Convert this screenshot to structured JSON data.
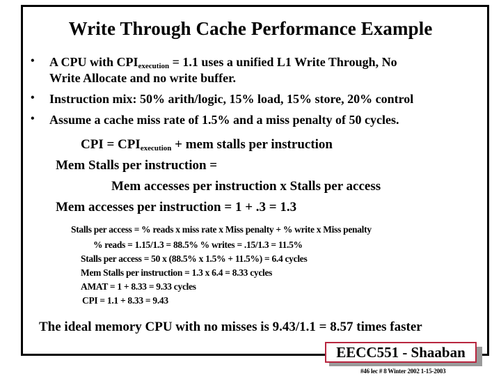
{
  "slide": {
    "title": "Write Through Cache Performance Example",
    "bullets": [
      {
        "pre": "A CPU with  CPI",
        "sub": "execution",
        "post": " =  1.1 uses a unified L1 Write Through, No",
        "line2": "Write Allocate and no write buffer."
      },
      {
        "text": "Instruction mix:   50% arith/logic,  15% load, 15% store, 20% control"
      },
      {
        "text": "Assume a cache miss rate of 1.5%  and  a miss penalty of 50 cycles."
      }
    ],
    "bullet_glyph": "•",
    "equations": {
      "cpi_pre": "CPI =    CPI",
      "cpi_sub": "execution",
      "cpi_post": "   +    mem stalls per instruction",
      "mem_stalls_label": "Mem Stalls per instruction =",
      "mem_stalls_expr": "Mem accesses per instruction  x  Stalls per access",
      "mem_accesses": "Mem accesses per instruction =  1  +   .3   =  1.3"
    },
    "calculations": [
      "Stalls per access =    % reads x miss rate  x Miss penalty +  % write   x Miss penalty",
      "% reads  =  1.15/1.3  =    88.5%          %  writes  =  .15/1.3 =  11.5%",
      "Stalls per access  =  50  x  (88.5%  x  1.5%  +  11.5%)  =  6.4 cycles",
      "Mem Stalls per instruction  =   1.3   x   6.4  =   8.33 cycles",
      "AMAT  =  1  +  8.33 =   9.33 cycles",
      "CPI =  1.1  + 8.33 =    9.43"
    ],
    "conclusion": "The ideal memory CPU with no misses is  9.43/1.1 =  8.57 times faster",
    "badge": "EECC551 - Shaaban",
    "footer_note": "#46   lec # 8   Winter 2002  1-15-2003",
    "colors": {
      "badge_border": "#b8263f",
      "badge_shadow": "#9a9a9a",
      "frame": "#000000"
    }
  }
}
